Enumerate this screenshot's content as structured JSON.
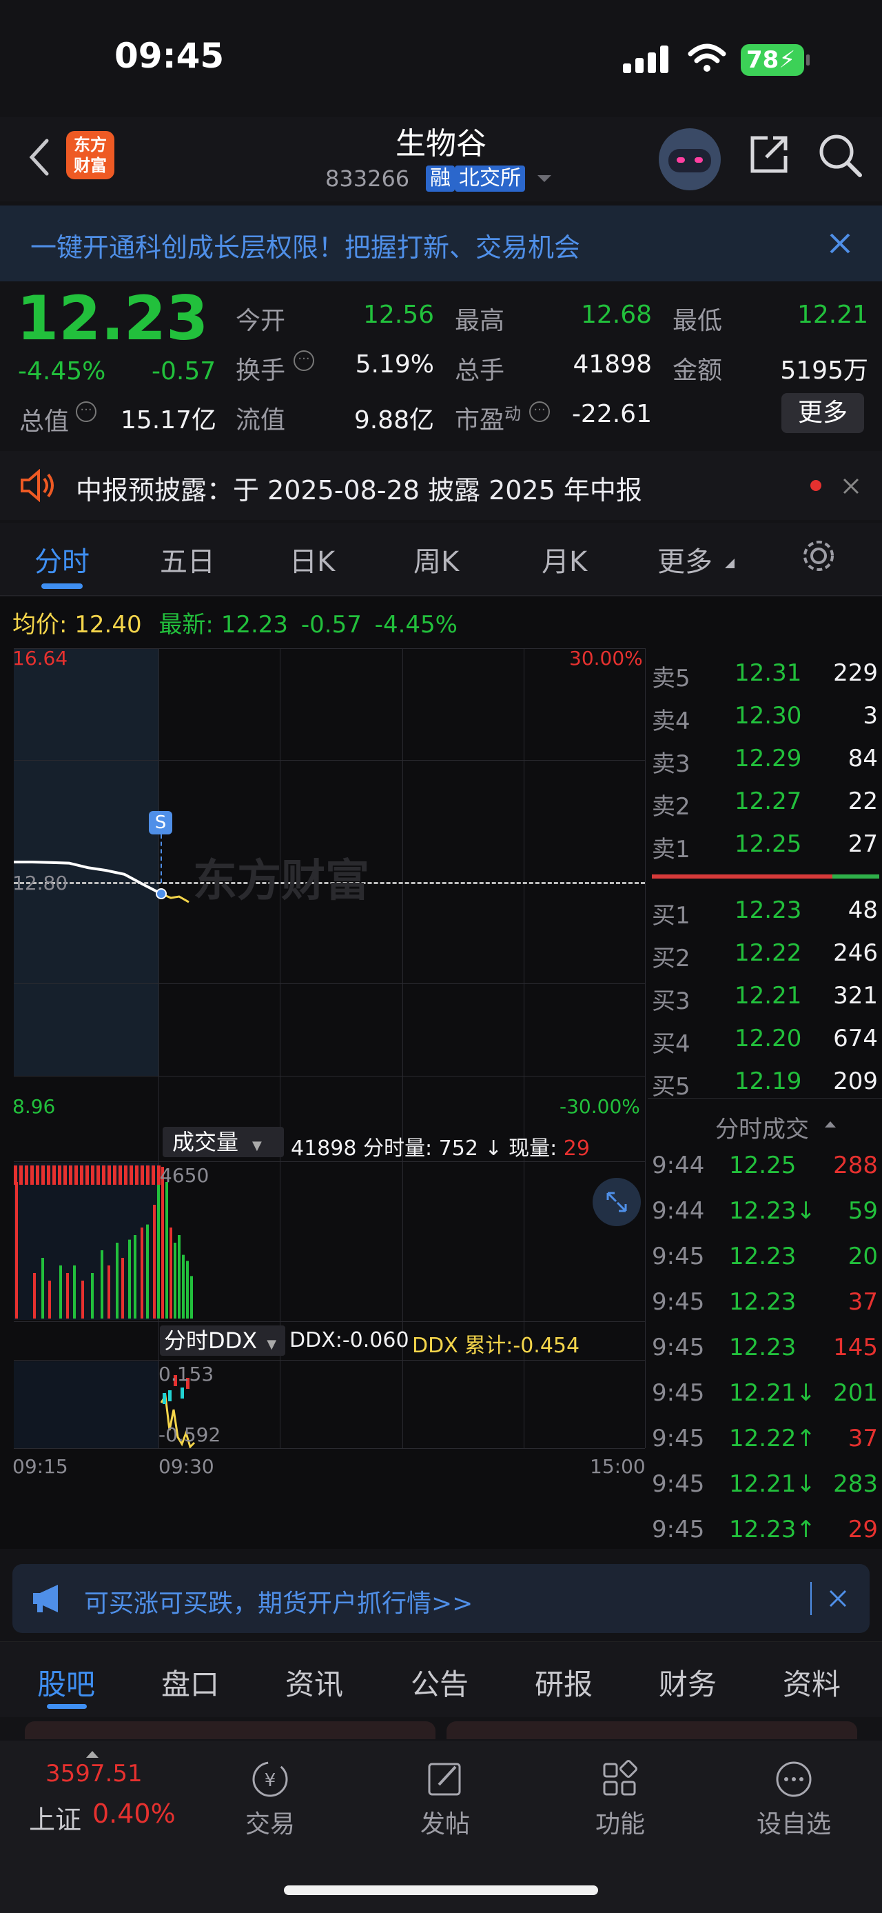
{
  "status_bar": {
    "time": "09:45",
    "battery": "78"
  },
  "header": {
    "logo_line1": "东方",
    "logo_line2": "财富",
    "title": "生物谷",
    "code": "833266",
    "badge_margin": "融",
    "badge_exchange": "北交所"
  },
  "banner": {
    "text": "一键开通科创成长层权限！把握打新、交易机会"
  },
  "quote": {
    "price": "12.23",
    "pct": "-4.45%",
    "change": "-0.57",
    "fields": [
      {
        "label": "今开",
        "value": "12.56"
      },
      {
        "label": "最高",
        "value": "12.68"
      },
      {
        "label": "最低",
        "value": "12.21"
      },
      {
        "label": "换手",
        "value": "5.19%"
      },
      {
        "label": "总手",
        "value": "41898"
      },
      {
        "label": "金额",
        "value": "5195万"
      },
      {
        "label": "总值",
        "value": "15.17亿"
      },
      {
        "label": "流值",
        "value": "9.88亿"
      },
      {
        "label": "市盈",
        "label_sup": "动",
        "value": "-22.61"
      }
    ],
    "more": "更多"
  },
  "notice": {
    "text": "中报预披露：于 2025-08-28 披露 2025 年中报"
  },
  "chart_tabs": [
    "分时",
    "五日",
    "日K",
    "周K",
    "月K",
    "更多"
  ],
  "chart_info": {
    "avg_label": "均价:",
    "avg": "12.40",
    "latest_label": "最新:",
    "latest": "12.23",
    "chg": "-0.57",
    "pct": "-4.45%"
  },
  "chart_axis": {
    "price_high": "16.64",
    "price_low": "8.96",
    "pct_high": "30.00%",
    "pct_low": "-30.00%",
    "prev_close": "12.80",
    "marker": "S",
    "watermark": "东方财富",
    "vol_selector": "成交量",
    "vol_total": "41898",
    "vol_min_label": "分时量:",
    "vol_min": "752",
    "vol_now_label": "现量:",
    "vol_now": "29",
    "vol_max": "4650",
    "ddx_selector": "分时DDX",
    "ddx": "DDX:-0.060",
    "ddx_cum": "DDX 累计:-0.454",
    "ddx_high": "0.153",
    "ddx_low": "-0.592",
    "time_start": "09:15",
    "time_mid": "09:30",
    "time_end": "15:00"
  },
  "chart_data": {
    "type": "line",
    "title": "分时",
    "x": [
      "09:30",
      "09:32",
      "09:34",
      "09:36",
      "09:38",
      "09:40",
      "09:42",
      "09:44",
      "09:45"
    ],
    "series": [
      {
        "name": "price",
        "values": [
          12.8,
          12.8,
          12.79,
          12.78,
          12.7,
          12.65,
          12.58,
          12.4,
          12.23
        ]
      }
    ],
    "ylim": [
      8.96,
      16.64
    ],
    "prev_close": 12.8
  },
  "order_book": {
    "asks": [
      {
        "label": "卖5",
        "price": "12.31",
        "qty": "229"
      },
      {
        "label": "卖4",
        "price": "12.30",
        "qty": "3"
      },
      {
        "label": "卖3",
        "price": "12.29",
        "qty": "84"
      },
      {
        "label": "卖2",
        "price": "12.27",
        "qty": "22"
      },
      {
        "label": "卖1",
        "price": "12.25",
        "qty": "27"
      }
    ],
    "bids": [
      {
        "label": "买1",
        "price": "12.23",
        "qty": "48"
      },
      {
        "label": "买2",
        "price": "12.22",
        "qty": "246"
      },
      {
        "label": "买3",
        "price": "12.21",
        "qty": "321"
      },
      {
        "label": "买4",
        "price": "12.20",
        "qty": "674"
      },
      {
        "label": "买5",
        "price": "12.19",
        "qty": "209"
      }
    ],
    "ticks_title": "分时成交",
    "ticks": [
      {
        "time": "9:44",
        "price": "12.25",
        "qty": "288",
        "dir": ""
      },
      {
        "time": "9:44",
        "price": "12.23↓",
        "qty": "59",
        "dir": ""
      },
      {
        "time": "9:45",
        "price": "12.23",
        "qty": "20",
        "dir": ""
      },
      {
        "time": "9:45",
        "price": "12.23",
        "qty": "37",
        "dir": ""
      },
      {
        "time": "9:45",
        "price": "12.23",
        "qty": "145",
        "dir": ""
      },
      {
        "time": "9:45",
        "price": "12.21↓",
        "qty": "201",
        "dir": ""
      },
      {
        "time": "9:45",
        "price": "12.22↑",
        "qty": "37",
        "dir": ""
      },
      {
        "time": "9:45",
        "price": "12.21↓",
        "qty": "283",
        "dir": ""
      },
      {
        "time": "9:45",
        "price": "12.23↑",
        "qty": "29",
        "dir": ""
      }
    ]
  },
  "ad": {
    "text": "可买涨可买跌，期货开户抓行情>>"
  },
  "bottom_tabs": [
    "股吧",
    "盘口",
    "资讯",
    "公告",
    "研报",
    "财务",
    "资料"
  ],
  "footer": {
    "index_value": "3597.51",
    "index_name": "上证",
    "index_pct": "0.40%",
    "items": [
      "交易",
      "发帖",
      "功能",
      "设自选"
    ]
  }
}
